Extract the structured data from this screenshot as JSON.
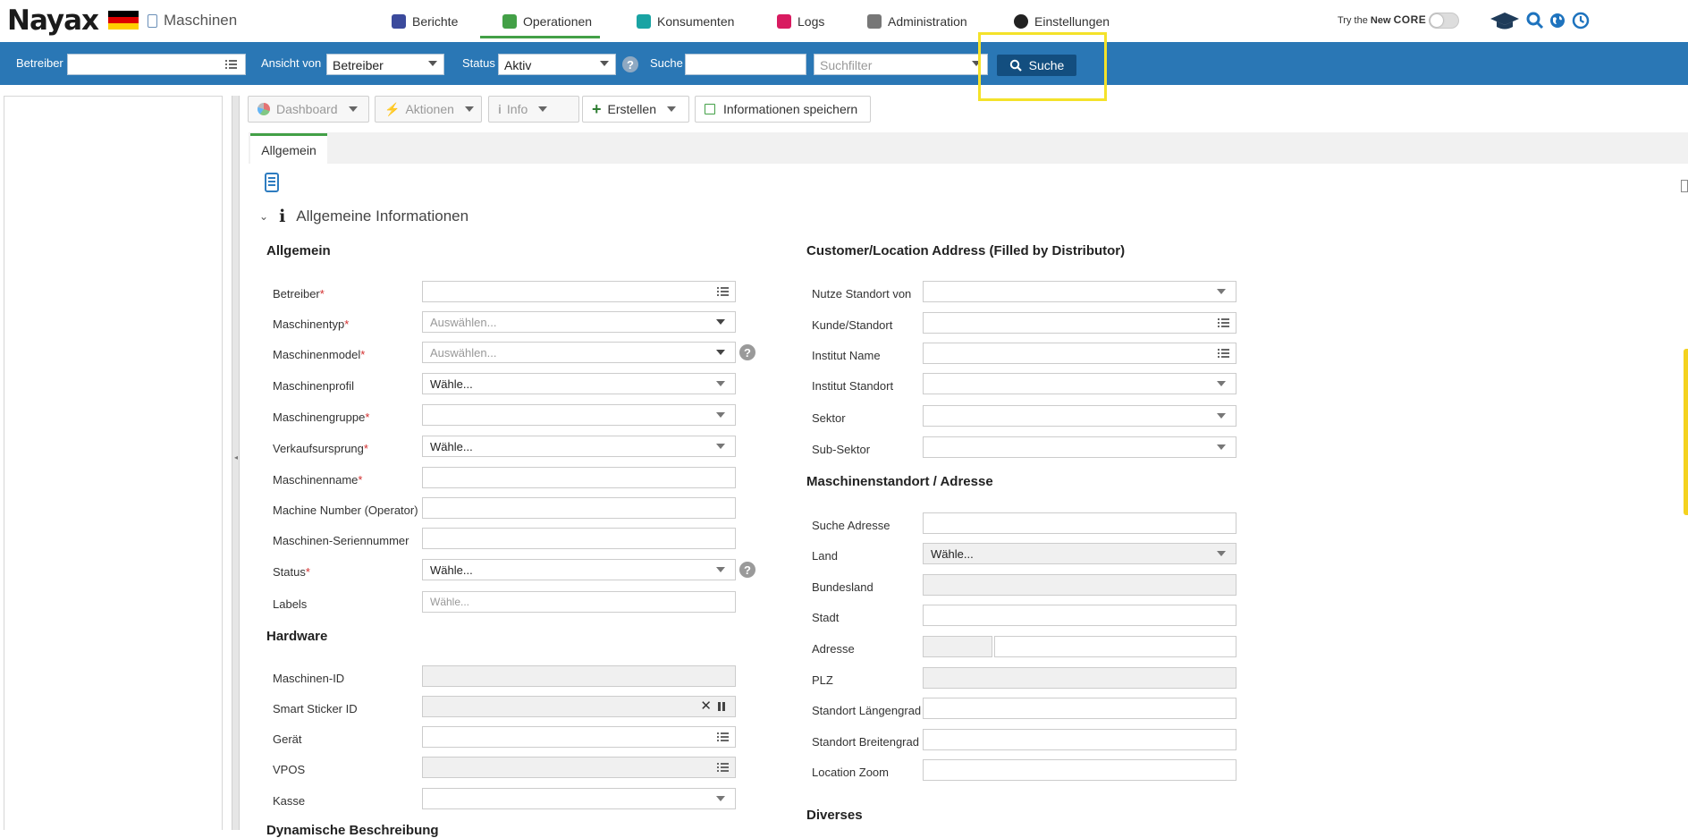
{
  "header": {
    "logo": "Nayax",
    "page_title": "Maschinen",
    "nav": [
      {
        "label": "Berichte",
        "color": "#3b4a9c"
      },
      {
        "label": "Operationen",
        "color": "#43a047"
      },
      {
        "label": "Konsumenten",
        "color": "#1aa3a3"
      },
      {
        "label": "Logs",
        "color": "#d81b60"
      },
      {
        "label": "Administration",
        "color": "#777777"
      },
      {
        "label": "Einstellungen",
        "color": "#222222"
      }
    ],
    "try_new_core_prefix": "Try the ",
    "try_new_core_new": "New",
    "try_new_core_core": "CORE"
  },
  "searchbar": {
    "betreiber_label": "Betreiber",
    "betreiber_value": "",
    "ansicht_label": "Ansicht von",
    "ansicht_value": "Betreiber",
    "status_label": "Status",
    "status_value": "Aktiv",
    "suche_label": "Suche",
    "suche_value": "",
    "suchfilter_placeholder": "Suchfilter",
    "search_button": "Suche"
  },
  "toolbar": {
    "dashboard": "Dashboard",
    "aktionen": "Aktionen",
    "info": "Info",
    "erstellen": "Erstellen",
    "save_info": "Informationen speichern"
  },
  "tabs": {
    "allgemein": "Allgemein"
  },
  "section": {
    "title": "Allgemeine Informationen"
  },
  "general": {
    "title": "Allgemein",
    "fields": {
      "betreiber": {
        "label": "Betreiber",
        "value": ""
      },
      "maschinentyp": {
        "label": "Maschinentyp",
        "placeholder": "Auswählen..."
      },
      "maschinenmodel": {
        "label": "Maschinenmodel",
        "placeholder": "Auswählen..."
      },
      "maschinenprofil": {
        "label": "Maschinenprofil",
        "value": "Wähle..."
      },
      "maschinengruppe": {
        "label": "Maschinengruppe",
        "value": ""
      },
      "verkaufsursprung": {
        "label": "Verkaufsursprung",
        "value": "Wähle..."
      },
      "maschinenname": {
        "label": "Maschinenname",
        "value": ""
      },
      "machine_number": {
        "label": "Machine Number (Operator)",
        "value": ""
      },
      "seriennummer": {
        "label": "Maschinen-Seriennummer",
        "value": ""
      },
      "status": {
        "label": "Status",
        "value": "Wähle..."
      },
      "labels": {
        "label": "Labels",
        "placeholder": "Wähle..."
      }
    }
  },
  "hardware": {
    "title": "Hardware",
    "fields": {
      "maschinen_id": {
        "label": "Maschinen-ID",
        "value": ""
      },
      "smart_sticker": {
        "label": "Smart Sticker ID",
        "value": ""
      },
      "geraet": {
        "label": "Gerät",
        "value": ""
      },
      "vpos": {
        "label": "VPOS",
        "value": ""
      },
      "kasse": {
        "label": "Kasse",
        "value": ""
      }
    }
  },
  "dynamic": {
    "title": "Dynamische Beschreibung"
  },
  "customer": {
    "title": "Customer/Location Address (Filled by Distributor)",
    "fields": {
      "nutze_standort": {
        "label": "Nutze Standort von",
        "value": ""
      },
      "kunde_standort": {
        "label": "Kunde/Standort",
        "value": ""
      },
      "institut_name": {
        "label": "Institut Name",
        "value": ""
      },
      "institut_standort": {
        "label": "Institut Standort",
        "value": ""
      },
      "sektor": {
        "label": "Sektor",
        "value": ""
      },
      "sub_sektor": {
        "label": "Sub-Sektor",
        "value": ""
      }
    }
  },
  "address": {
    "title": "Maschinenstandort / Adresse",
    "fields": {
      "suche_adresse": {
        "label": "Suche Adresse",
        "value": ""
      },
      "land": {
        "label": "Land",
        "value": "Wähle..."
      },
      "bundesland": {
        "label": "Bundesland",
        "value": ""
      },
      "stadt": {
        "label": "Stadt",
        "value": ""
      },
      "adresse": {
        "label": "Adresse",
        "value": ""
      },
      "plz": {
        "label": "PLZ",
        "value": ""
      },
      "laengengrad": {
        "label": "Standort Längengrad",
        "value": ""
      },
      "breitengrad": {
        "label": "Standort Breitengrad",
        "value": ""
      },
      "location_zoom": {
        "label": "Location Zoom",
        "value": ""
      }
    }
  },
  "diverses": {
    "title": "Diverses"
  }
}
